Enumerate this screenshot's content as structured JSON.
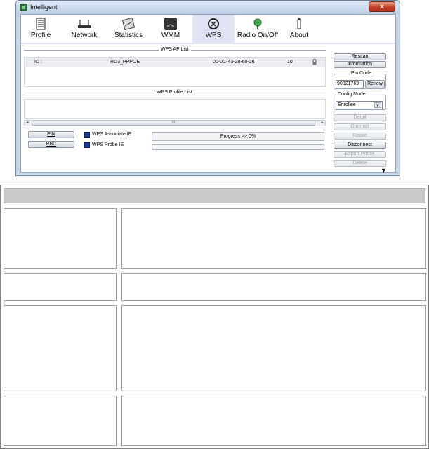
{
  "window": {
    "title": "Intelligent",
    "close_glyph": "x"
  },
  "toolbar": {
    "items": [
      {
        "label": "Profile",
        "icon": "profile-icon"
      },
      {
        "label": "Network",
        "icon": "network-icon"
      },
      {
        "label": "Statistics",
        "icon": "statistics-icon"
      },
      {
        "label": "WMM",
        "icon": "wmm-icon"
      },
      {
        "label": "WPS",
        "icon": "wps-icon",
        "active": true
      },
      {
        "label": "Radio On/Off",
        "icon": "radio-icon"
      },
      {
        "label": "About",
        "icon": "about-icon"
      }
    ]
  },
  "wps_ap_list": {
    "title": "WPS AP List",
    "rows": [
      {
        "id_label": "ID :",
        "ssid": "RD3_PPPOE",
        "bssid": "00-0C-43-28-60-26",
        "channel": "10"
      }
    ]
  },
  "wps_profile_list": {
    "title": "WPS Profile List",
    "scroll_grip": "III"
  },
  "controls": {
    "pin_label": "PIN",
    "pbc_label": "PBC",
    "associate_ie_label": "WPS Associate IE",
    "probe_ie_label": "WPS Probe IE",
    "progress_text": "Progress >> 0%"
  },
  "right_panel": {
    "rescan": "Rescan",
    "information": "Information",
    "pin_code_title": "Pin Code",
    "pin_code_value": "90821769",
    "renew": "Renew",
    "config_mode_title": "Config Mode",
    "config_mode_value": "Enrollee",
    "detail": "Detail",
    "connect": "Connect",
    "rotate": "Rotate",
    "disconnect": "Disconnect",
    "export_profile": "Export Profile",
    "delete": "Delete"
  },
  "colors": {
    "window_frame": "#c6d7ea",
    "close_button": "#c4402a",
    "active_tab": "#dfe3f5",
    "checkbox": "#1c3f9c",
    "table_header": "#c8c8c8"
  }
}
